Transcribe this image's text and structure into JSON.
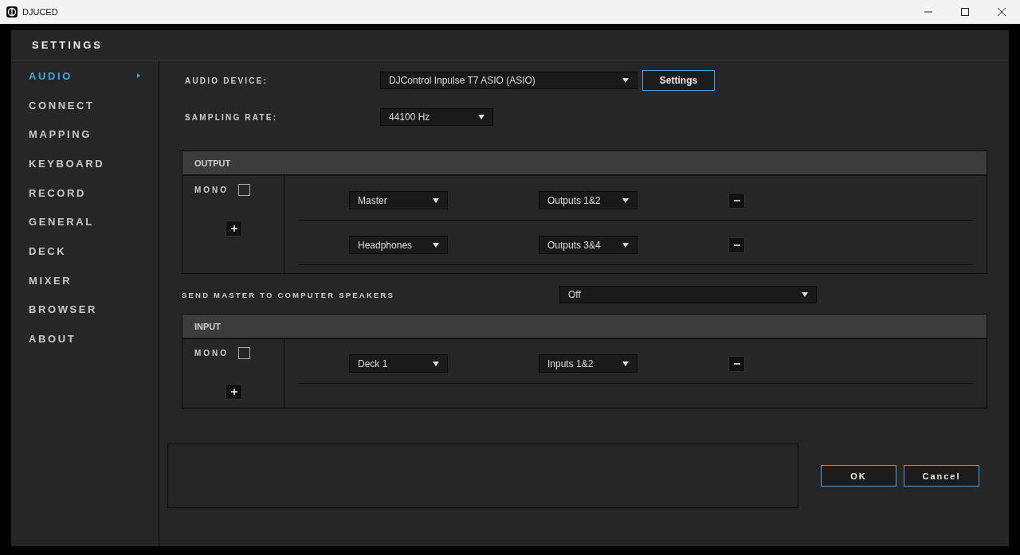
{
  "window": {
    "title": "DJUCED"
  },
  "header": {
    "title": "SETTINGS"
  },
  "sidebar": {
    "items": [
      {
        "label": "AUDIO",
        "selected": true
      },
      {
        "label": "CONNECT",
        "selected": false
      },
      {
        "label": "MAPPING",
        "selected": false
      },
      {
        "label": "KEYBOARD",
        "selected": false
      },
      {
        "label": "RECORD",
        "selected": false
      },
      {
        "label": "GENERAL",
        "selected": false
      },
      {
        "label": "DECK",
        "selected": false
      },
      {
        "label": "MIXER",
        "selected": false
      },
      {
        "label": "BROWSER",
        "selected": false
      },
      {
        "label": "ABOUT",
        "selected": false
      }
    ]
  },
  "audio_device": {
    "label": "AUDIO DEVICE:",
    "value": "DJControl Inpulse T7 ASIO (ASIO)",
    "button": "Settings"
  },
  "sampling_rate": {
    "label": "SAMPLING RATE:",
    "value": "44100 Hz"
  },
  "output": {
    "title": "OUTPUT",
    "mono": {
      "label": "MONO",
      "checked": false
    },
    "rows": [
      {
        "source": "Master",
        "channel": "Outputs 1&2"
      },
      {
        "source": "Headphones",
        "channel": "Outputs 3&4"
      }
    ]
  },
  "send_master": {
    "label": "SEND MASTER TO COMPUTER SPEAKERS",
    "value": "Off"
  },
  "input": {
    "title": "INPUT",
    "mono": {
      "label": "MONO",
      "checked": false
    },
    "rows": [
      {
        "source": "Deck 1",
        "channel": "Inputs 1&2"
      }
    ]
  },
  "buttons": {
    "ok": "OK",
    "cancel": "Cancel"
  }
}
